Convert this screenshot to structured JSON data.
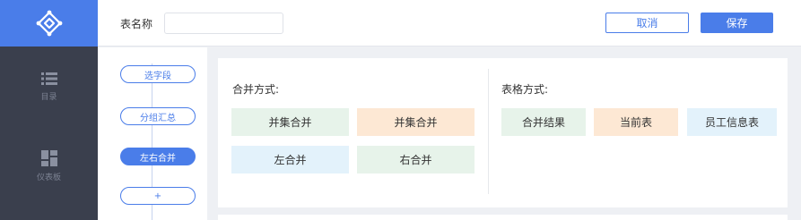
{
  "sidebar": {
    "items": [
      {
        "label": "目录",
        "icon": "list-icon"
      },
      {
        "label": "仪表板",
        "icon": "dashboard-icon"
      }
    ]
  },
  "header": {
    "table_name_label": "表名称",
    "table_name_value": "",
    "cancel_label": "取消",
    "save_label": "保存"
  },
  "steps": {
    "items": [
      {
        "label": "选字段"
      },
      {
        "label": "分组汇总"
      },
      {
        "label": "左右合并"
      },
      {
        "label": "+"
      }
    ],
    "active_index": 2
  },
  "merge": {
    "title": "合并方式:",
    "options": [
      {
        "label": "并集合并"
      },
      {
        "label": "并集合并"
      },
      {
        "label": "左合并"
      },
      {
        "label": "右合并"
      }
    ]
  },
  "table_mode": {
    "title": "表格方式:",
    "options": [
      {
        "label": "合并结果"
      },
      {
        "label": "当前表"
      },
      {
        "label": "员工信息表"
      }
    ]
  },
  "colors": {
    "accent": "#4a7de9",
    "sidebar_bg": "#3a3f4d",
    "tile_green": "#e7f3ea",
    "tile_orange": "#fde8d4",
    "tile_blue": "#e3f2fb"
  }
}
